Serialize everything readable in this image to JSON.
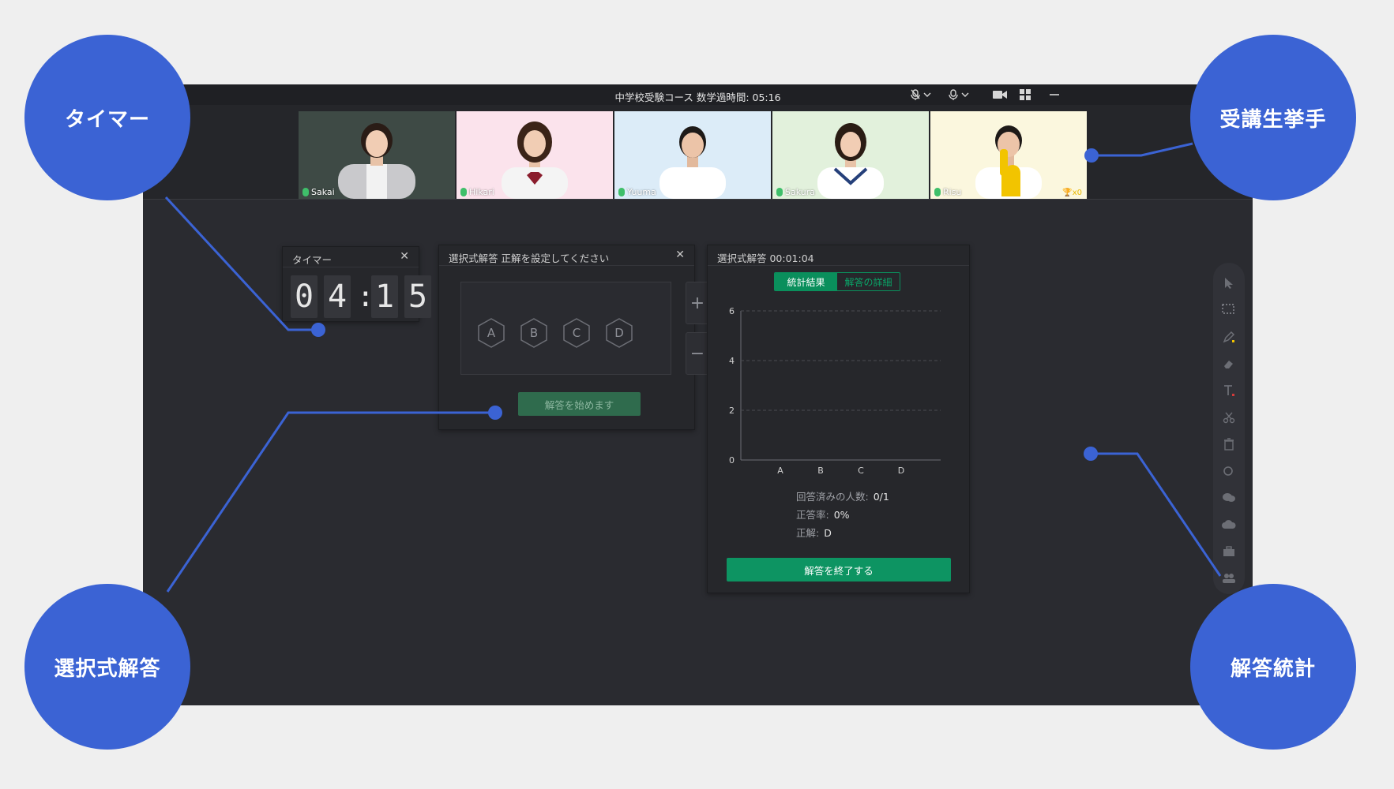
{
  "window": {
    "title": "中学校受験コース 数学過時間: 05:16"
  },
  "participants": [
    {
      "name": "Sakai",
      "bg": "#3e4a45",
      "role": "teacher"
    },
    {
      "name": "Hikari",
      "bg": "#fbe3ec",
      "role": "student"
    },
    {
      "name": "Yuuma",
      "bg": "#dcecf8",
      "role": "student"
    },
    {
      "name": "Sakura",
      "bg": "#e2f1dc",
      "role": "student"
    },
    {
      "name": "Risu",
      "bg": "#fbf7de",
      "role": "student",
      "trophy": "x0"
    }
  ],
  "timer": {
    "title": "タイマー",
    "digits": [
      "0",
      "4",
      "1",
      "5"
    ]
  },
  "quiz": {
    "title": "選択式解答  正解を設定してください",
    "options": [
      "A",
      "B",
      "C",
      "D"
    ],
    "add": "+",
    "remove": "−",
    "start_label": "解答を始めます"
  },
  "results": {
    "title": "選択式解答  00:01:04",
    "tabs": [
      "統計結果",
      "解答の詳細"
    ],
    "answered_label": "回答済みの人数:",
    "answered_value": "0/1",
    "accuracy_label": "正答率:",
    "accuracy_value": "0%",
    "correct_label": "正解:",
    "correct_value": "D",
    "end_label": "解答を終了する"
  },
  "chart_data": {
    "type": "bar",
    "categories": [
      "A",
      "B",
      "C",
      "D"
    ],
    "values": [
      0,
      0,
      0,
      0
    ],
    "yticks": [
      "0",
      "2",
      "4",
      "6"
    ],
    "ylim": [
      0,
      6
    ],
    "grid": true
  },
  "callouts": {
    "timer": "タイマー",
    "raise_hand": "受講生挙手",
    "multiple_choice": "選択式解答",
    "statistics": "解答統計"
  },
  "colors": {
    "accent_blue": "#3b63d4",
    "accent_green": "#0d9462",
    "raise_hand_yellow": "#f2c400"
  }
}
